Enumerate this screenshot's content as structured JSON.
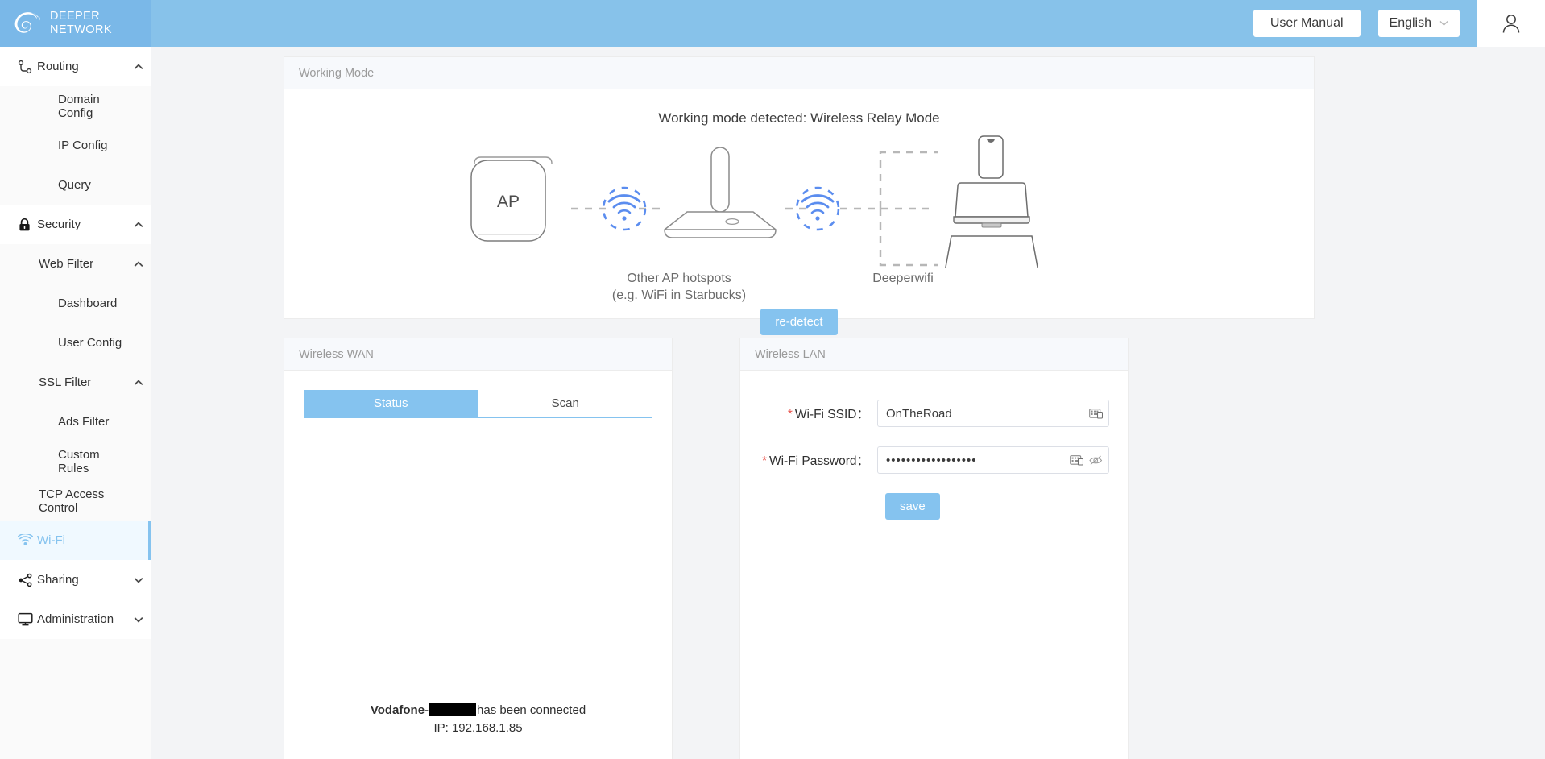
{
  "brand": {
    "line1": "DEEPER",
    "line2": "NETWORK",
    "logo_icon": "deeper-spiral-logo"
  },
  "header": {
    "user_manual_label": "User Manual",
    "language_value": "English",
    "language_caret_icon": "chevron-down-icon",
    "account_icon": "user-account-icon",
    "bg_color": "#87c2ea"
  },
  "sidebar": {
    "items": [
      {
        "label": "Routing",
        "depth": 0,
        "icon": "route-icon",
        "chevron": "chevron-up-icon",
        "active": false
      },
      {
        "label": "Domain Config",
        "depth": 2,
        "icon": "",
        "chevron": "",
        "active": false
      },
      {
        "label": "IP Config",
        "depth": 2,
        "icon": "",
        "chevron": "",
        "active": false
      },
      {
        "label": "Query",
        "depth": 2,
        "icon": "",
        "chevron": "",
        "active": false
      },
      {
        "label": "Security",
        "depth": 0,
        "icon": "lock-icon",
        "chevron": "chevron-up-icon",
        "active": false
      },
      {
        "label": "Web Filter",
        "depth": 1,
        "icon": "",
        "chevron": "chevron-up-icon",
        "active": false
      },
      {
        "label": "Dashboard",
        "depth": 2,
        "icon": "",
        "chevron": "",
        "active": false
      },
      {
        "label": "User Config",
        "depth": 2,
        "icon": "",
        "chevron": "",
        "active": false
      },
      {
        "label": "SSL Filter",
        "depth": 1,
        "icon": "",
        "chevron": "chevron-up-icon",
        "active": false
      },
      {
        "label": "Ads Filter",
        "depth": 2,
        "icon": "",
        "chevron": "",
        "active": false
      },
      {
        "label": "Custom Rules",
        "depth": 2,
        "icon": "",
        "chevron": "",
        "active": false
      },
      {
        "label": "TCP Access Control",
        "depth": 1,
        "icon": "",
        "chevron": "",
        "active": false
      },
      {
        "label": "Wi-Fi",
        "depth": 0,
        "icon": "wifi-icon",
        "chevron": "",
        "active": true
      },
      {
        "label": "Sharing",
        "depth": 0,
        "icon": "share-icon",
        "chevron": "chevron-down-icon",
        "active": false
      },
      {
        "label": "Administration",
        "depth": 0,
        "icon": "monitor-icon",
        "chevron": "chevron-down-icon",
        "active": false
      }
    ],
    "active_color": "#85c3ef"
  },
  "working_mode": {
    "panel_title": "Working Mode",
    "detected_text": "Working mode detected: Wireless Relay Mode",
    "ap_device_label": "AP",
    "ap_caption_line1": "Other AP hotspots",
    "ap_caption_line2": "(e.g. WiFi in Starbucks)",
    "deeper_caption": "Deeperwifi",
    "redetect_label": "re-detect",
    "wifi_signal_color": "#5b8def",
    "client_devices": [
      "phone-icon",
      "monitor-icon",
      "laptop-icon"
    ]
  },
  "wireless_wan": {
    "panel_title": "Wireless WAN",
    "tabs": [
      {
        "label": "Status",
        "selected": true
      },
      {
        "label": "Scan",
        "selected": false
      }
    ],
    "status_prefix": "Vodafone-",
    "status_suffix": "has been connected",
    "ip_text": "IP: 192.168.1.85"
  },
  "wireless_lan": {
    "panel_title": "Wireless LAN",
    "ssid_label": "Wi-Fi SSID：",
    "ssid_value": "OnTheRoad",
    "password_label": "Wi-Fi Password：",
    "password_masked": "••••••••••••••••••",
    "keyboard_icon": "keyboard-icon",
    "eye_off_icon": "eye-off-icon",
    "save_label": "save",
    "required_marker": "*"
  }
}
